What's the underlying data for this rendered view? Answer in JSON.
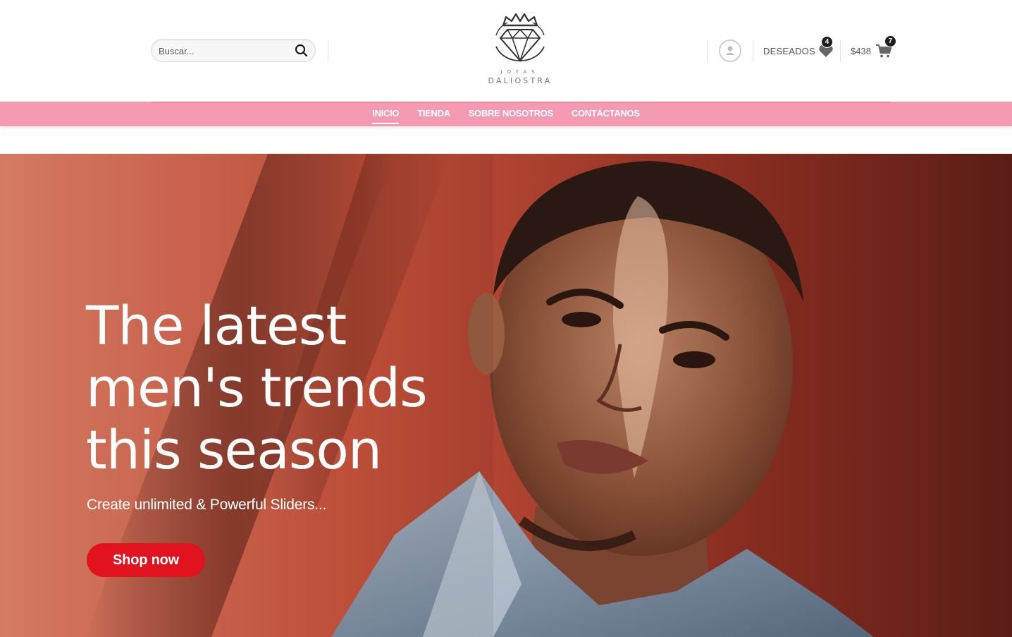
{
  "header": {
    "search": {
      "placeholder": "Buscar...",
      "icon": "search-icon"
    },
    "logo": {
      "small": "JOYAS",
      "main": "DALIOSTRA"
    },
    "account": {
      "icon": "user-icon"
    },
    "wishlist": {
      "label": "DESEADOS",
      "count": "4",
      "icon": "heart-icon"
    },
    "cart": {
      "total": "$438",
      "count": "7",
      "icon": "cart-icon"
    }
  },
  "nav": {
    "items": [
      {
        "label": "INICIO",
        "active": true
      },
      {
        "label": "TIENDA",
        "active": false
      },
      {
        "label": "SOBRE NOSOTROS",
        "active": false
      },
      {
        "label": "CONTÁCTANOS",
        "active": false
      }
    ],
    "color": "#f49bb3"
  },
  "hero": {
    "title_line1": "The latest",
    "title_line2": "men's trends",
    "title_line3": "this season",
    "subtitle": "Create unlimited & Powerful Sliders...",
    "button": "Shop now",
    "button_color": "#e0131e"
  }
}
